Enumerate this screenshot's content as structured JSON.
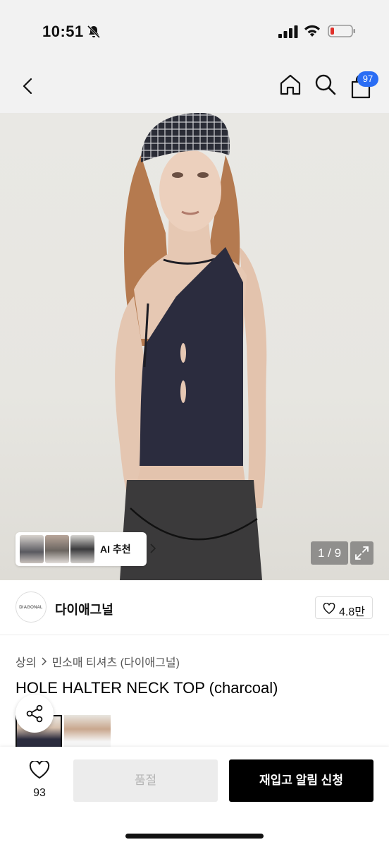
{
  "status_bar": {
    "time": "10:51"
  },
  "nav": {
    "cart_count": "97"
  },
  "hero": {
    "ai_recommend_label": "AI 추천",
    "image_counter": "1 / 9"
  },
  "brand": {
    "logo_text": "DIAGONAL",
    "name": "다이애그널",
    "like_count": "4.8만"
  },
  "product": {
    "breadcrumb": [
      "상의",
      "민소매 티셔츠 (다이애그널)"
    ],
    "title": "HOLE HALTER NECK TOP (charcoal)"
  },
  "bottom_bar": {
    "wish_count": "93",
    "soldout_label": "품절",
    "restock_label": "재입고 알림 신청"
  },
  "colors": {
    "accent_badge": "#2a6df4",
    "primary_button": "#000000",
    "disabled_button": "#ececec"
  }
}
